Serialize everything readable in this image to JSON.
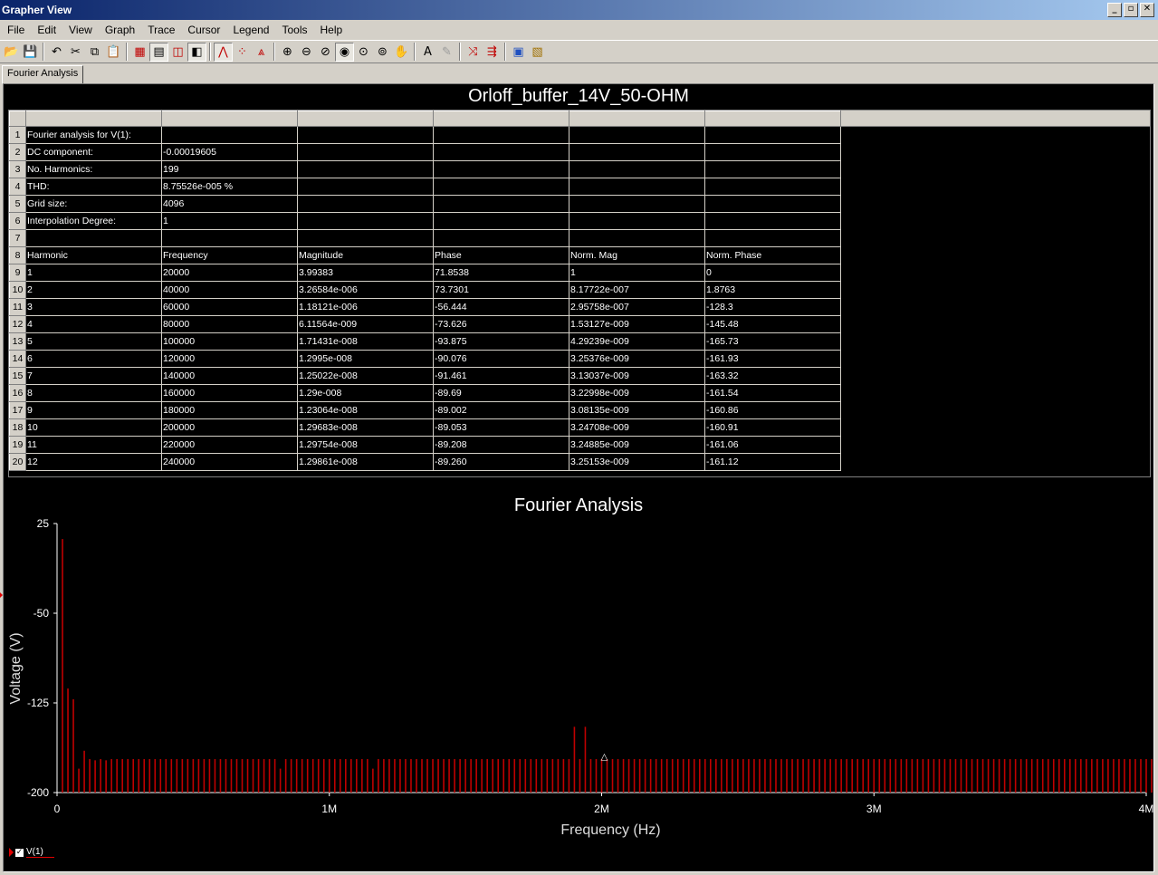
{
  "window": {
    "title": "Grapher View",
    "controls": [
      "_",
      "▫",
      "✕"
    ]
  },
  "menu": [
    "File",
    "Edit",
    "View",
    "Graph",
    "Trace",
    "Cursor",
    "Legend",
    "Tools",
    "Help"
  ],
  "toolbar": [
    {
      "name": "open-icon",
      "glyph": "📂"
    },
    {
      "name": "save-icon",
      "glyph": "💾"
    },
    {
      "sep": true
    },
    {
      "name": "undo-icon",
      "glyph": "↶"
    },
    {
      "name": "cut-icon",
      "glyph": "✂"
    },
    {
      "name": "copy-icon",
      "glyph": "⧉"
    },
    {
      "name": "paste-icon",
      "glyph": "📋"
    },
    {
      "sep": true
    },
    {
      "name": "grid-icon",
      "glyph": "▦",
      "color": "#c00000"
    },
    {
      "name": "table-icon",
      "glyph": "▤",
      "pressed": true
    },
    {
      "name": "graph-icon",
      "glyph": "◫",
      "color": "#c00000"
    },
    {
      "name": "overlay-icon",
      "glyph": "◧",
      "pressed": true
    },
    {
      "sep": true
    },
    {
      "name": "line-trace-icon",
      "glyph": "⋀",
      "color": "#c00000",
      "pressed": true
    },
    {
      "name": "point-trace-icon",
      "glyph": "⁘",
      "color": "#c00000"
    },
    {
      "name": "line-point-trace-icon",
      "glyph": "⩓",
      "color": "#c00000"
    },
    {
      "sep": true
    },
    {
      "name": "zoom-in-icon",
      "glyph": "⊕"
    },
    {
      "name": "zoom-out-icon",
      "glyph": "⊖"
    },
    {
      "name": "zoom-area-icon",
      "glyph": "⊘"
    },
    {
      "name": "zoom-full-icon",
      "glyph": "◉",
      "pressed": true
    },
    {
      "name": "zoom-x-icon",
      "glyph": "⊙"
    },
    {
      "name": "zoom-y-icon",
      "glyph": "⊚"
    },
    {
      "name": "pan-hand-icon",
      "glyph": "✋"
    },
    {
      "sep": true
    },
    {
      "name": "text-icon",
      "glyph": "A"
    },
    {
      "name": "annotation-icon",
      "glyph": "✎",
      "color": "#9a9a9a"
    },
    {
      "sep": true
    },
    {
      "name": "cursor-trace-icon",
      "glyph": "⤨",
      "color": "#c00000"
    },
    {
      "name": "export-icon",
      "glyph": "⇶",
      "color": "#c00000"
    },
    {
      "sep": true
    },
    {
      "name": "properties-icon",
      "glyph": "▣",
      "color": "#2050c0"
    },
    {
      "name": "page-setup-icon",
      "glyph": "▧",
      "color": "#a07000"
    }
  ],
  "tabs": [
    {
      "label": "Fourier Analysis",
      "active": true
    }
  ],
  "document_title": "Orloff_buffer_14V_50-OHM",
  "sheet": {
    "rows": [
      [
        "1",
        "Fourier analysis for V(1):",
        "",
        "",
        "",
        "",
        ""
      ],
      [
        "2",
        "DC component:",
        "-0.00019605",
        "",
        "",
        "",
        ""
      ],
      [
        "3",
        "No. Harmonics:",
        "199",
        "",
        "",
        "",
        ""
      ],
      [
        "4",
        "THD:",
        "8.75526e-005 %",
        "",
        "",
        "",
        ""
      ],
      [
        "5",
        "Grid size:",
        "4096",
        "",
        "",
        "",
        ""
      ],
      [
        "6",
        "Interpolation Degree:",
        "1",
        "",
        "",
        "",
        ""
      ],
      [
        "7",
        "",
        "",
        "",
        "",
        "",
        ""
      ],
      [
        "8",
        "Harmonic",
        "Frequency",
        "Magnitude",
        "Phase",
        "Norm. Mag",
        "Norm. Phase"
      ],
      [
        "9",
        "1",
        "20000",
        "3.99383",
        "71.8538",
        "1",
        "0"
      ],
      [
        "10",
        "2",
        "40000",
        "3.26584e-006",
        "73.7301",
        "8.17722e-007",
        "1.8763"
      ],
      [
        "11",
        "3",
        "60000",
        "1.18121e-006",
        "-56.444",
        "2.95758e-007",
        "-128.3"
      ],
      [
        "12",
        "4",
        "80000",
        "6.11564e-009",
        "-73.626",
        "1.53127e-009",
        "-145.48"
      ],
      [
        "13",
        "5",
        "100000",
        "1.71431e-008",
        "-93.875",
        "4.29239e-009",
        "-165.73"
      ],
      [
        "14",
        "6",
        "120000",
        "1.2995e-008",
        "-90.076",
        "3.25376e-009",
        "-161.93"
      ],
      [
        "15",
        "7",
        "140000",
        "1.25022e-008",
        "-91.461",
        "3.13037e-009",
        "-163.32"
      ],
      [
        "16",
        "8",
        "160000",
        "1.29e-008",
        "-89.69",
        "3.22998e-009",
        "-161.54"
      ],
      [
        "17",
        "9",
        "180000",
        "1.23064e-008",
        "-89.002",
        "3.08135e-009",
        "-160.86"
      ],
      [
        "18",
        "10",
        "200000",
        "1.29683e-008",
        "-89.053",
        "3.24708e-009",
        "-160.91"
      ],
      [
        "19",
        "11",
        "220000",
        "1.29754e-008",
        "-89.208",
        "3.24885e-009",
        "-161.06"
      ],
      [
        "20",
        "12",
        "240000",
        "1.29861e-008",
        "-89.260",
        "3.25153e-009",
        "-161.12"
      ]
    ]
  },
  "chart_data": {
    "type": "bar",
    "title": "Fourier Analysis",
    "xlabel": "Frequency (Hz)",
    "ylabel": "Voltage (V)",
    "xlim": [
      0,
      4000000
    ],
    "ylim": [
      -200,
      25
    ],
    "x_ticks": [
      {
        "v": 0,
        "label": "0"
      },
      {
        "v": 1000000,
        "label": "1M"
      },
      {
        "v": 2000000,
        "label": "2M"
      },
      {
        "v": 3000000,
        "label": "3M"
      },
      {
        "v": 4000000,
        "label": "4M"
      }
    ],
    "y_ticks": [
      {
        "v": 25,
        "label": "25"
      },
      {
        "v": -50,
        "label": "-50"
      },
      {
        "v": -125,
        "label": "-125"
      },
      {
        "v": -200,
        "label": "-200"
      }
    ],
    "grid": false,
    "color": "#c00000",
    "series": [
      {
        "name": "V(1)",
        "x_start": 20000,
        "x_step": 20000,
        "values": [
          12,
          -113,
          -122,
          -180,
          -165,
          -172,
          -173,
          -172,
          -173,
          -172,
          -172,
          -172,
          -172,
          -172,
          -172,
          -172,
          -172,
          -172,
          -172,
          -172,
          -172,
          -172,
          -172,
          -172,
          -172,
          -172,
          -172,
          -172,
          -172,
          -172,
          -172,
          -172,
          -172,
          -172,
          -172,
          -172,
          -172,
          -172,
          -172,
          -172,
          -180,
          -172,
          -172,
          -172,
          -172,
          -172,
          -172,
          -172,
          -172,
          -172,
          -172,
          -172,
          -172,
          -172,
          -172,
          -172,
          -172,
          -180,
          -172,
          -172,
          -172,
          -172,
          -172,
          -172,
          -172,
          -172,
          -172,
          -172,
          -172,
          -172,
          -172,
          -172,
          -172,
          -172,
          -172,
          -172,
          -172,
          -172,
          -172,
          -172,
          -172,
          -172,
          -172,
          -172,
          -172,
          -172,
          -172,
          -172,
          -172,
          -172,
          -172,
          -172,
          -172,
          -172,
          -145,
          -172,
          -145,
          -172,
          -172,
          -172,
          -172,
          -172,
          -172,
          -172,
          -172,
          -172,
          -172,
          -172,
          -172,
          -172,
          -172,
          -172,
          -172,
          -172,
          -172,
          -172,
          -172,
          -172,
          -172,
          -172,
          -172,
          -172,
          -172,
          -172,
          -172,
          -172,
          -172,
          -172,
          -172,
          -172,
          -172,
          -172,
          -172,
          -172,
          -172,
          -172,
          -172,
          -172,
          -172,
          -172,
          -172,
          -172,
          -172,
          -172,
          -172,
          -172,
          -172,
          -172,
          -172,
          -172,
          -172,
          -172,
          -172,
          -172,
          -172,
          -172,
          -172,
          -172,
          -172,
          -172,
          -172,
          -172,
          -172,
          -172,
          -172,
          -172,
          -172,
          -172,
          -172,
          -172,
          -172,
          -172,
          -172,
          -172,
          -172,
          -172,
          -172,
          -172,
          -172,
          -172,
          -172,
          -172,
          -172,
          -172,
          -172,
          -172,
          -172,
          -172,
          -172,
          -172,
          -172,
          -172,
          -172,
          -172,
          -172,
          -172,
          -172,
          -172,
          -172,
          -172,
          -172,
          -172,
          -172,
          -172,
          -172
        ]
      }
    ],
    "marker": {
      "x": 2010000,
      "y": -171,
      "symbol": "△"
    }
  },
  "legend": {
    "label": "V(1)",
    "checked": true,
    "check_glyph": "✓"
  }
}
